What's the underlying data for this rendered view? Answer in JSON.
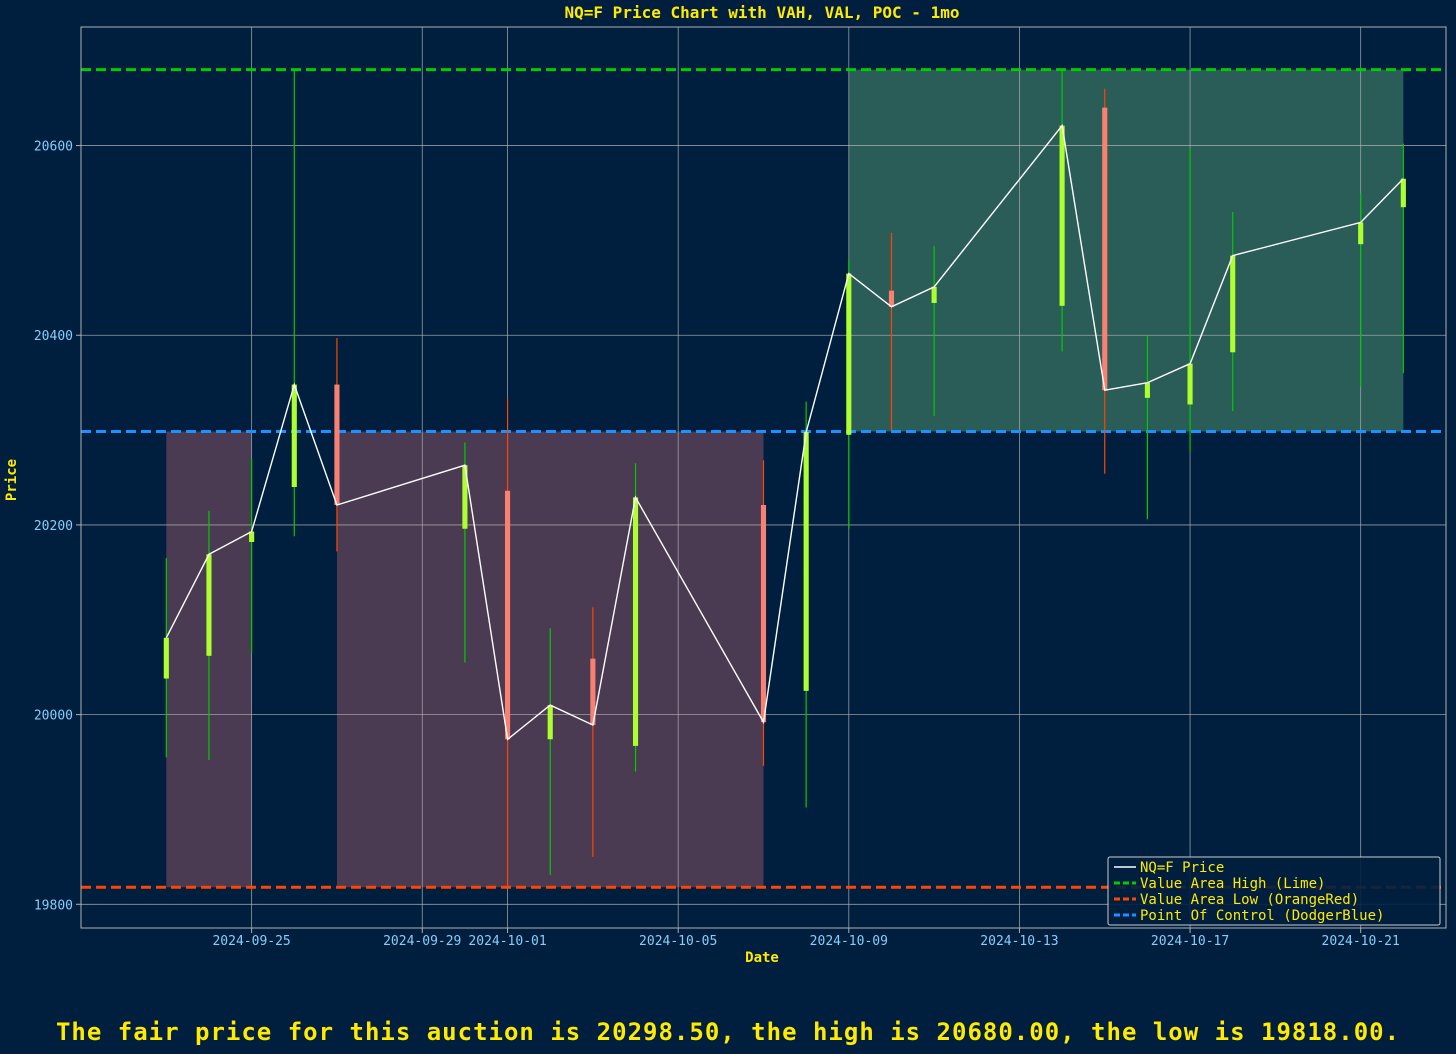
{
  "chart_data": {
    "type": "candlestick",
    "title": "NQ=F Price Chart with VAH, VAL, POC - 1mo",
    "xlabel": "Date",
    "ylabel": "Price",
    "ylim": [
      19775,
      20725
    ],
    "xlim": [
      "2024-09-21",
      "2024-10-23"
    ],
    "x_ticks": [
      "2024-09-25",
      "2024-09-29",
      "2024-10-01",
      "2024-10-05",
      "2024-10-09",
      "2024-10-13",
      "2024-10-17",
      "2024-10-21"
    ],
    "y_ticks": [
      19800,
      20000,
      20200,
      20400,
      20600
    ],
    "grid": true,
    "legend_position": "bottom-right",
    "legend": [
      {
        "label": "NQ=F Price",
        "color": "#ffffff",
        "style": "solid"
      },
      {
        "label": "Value Area High (Lime)",
        "color": "#00cc00",
        "style": "dashed"
      },
      {
        "label": "Value Area Low (OrangeRed)",
        "color": "#ff4500",
        "style": "dashed"
      },
      {
        "label": "Point Of Control (DodgerBlue)",
        "color": "#1e90ff",
        "style": "dashed"
      }
    ],
    "levels": {
      "vah": 20680.0,
      "val": 19818.0,
      "poc": 20298.5
    },
    "colors": {
      "background": "#001f3f",
      "up": "#adff2f",
      "down": "#fa8072",
      "up_wick": "#00cc00",
      "down_wick": "#ff4500",
      "title": "#ffea00",
      "tick": "#87cefa",
      "below_poc_region": "#4a3a52",
      "above_poc_region": "#2a5c58"
    },
    "candles": [
      {
        "date": "2024-09-23",
        "open": 20038,
        "high": 20165,
        "low": 19955,
        "close": 20081
      },
      {
        "date": "2024-09-24",
        "open": 20062,
        "high": 20215,
        "low": 19952,
        "close": 20169
      },
      {
        "date": "2024-09-25",
        "open": 20182,
        "high": 20270,
        "low": 20065,
        "close": 20193
      },
      {
        "date": "2024-09-26",
        "open": 20240,
        "high": 20680,
        "low": 20188,
        "close": 20348
      },
      {
        "date": "2024-09-27",
        "open": 20348,
        "high": 20397,
        "low": 20172,
        "close": 20221
      },
      {
        "date": "2024-09-30",
        "open": 20196,
        "high": 20287,
        "low": 20055,
        "close": 20263
      },
      {
        "date": "2024-10-01",
        "open": 20236,
        "high": 20333,
        "low": 19818,
        "close": 19974
      },
      {
        "date": "2024-10-02",
        "open": 19974,
        "high": 20091,
        "low": 19831,
        "close": 20010
      },
      {
        "date": "2024-10-03",
        "open": 20059,
        "high": 20113,
        "low": 19850,
        "close": 19989
      },
      {
        "date": "2024-10-04",
        "open": 19967,
        "high": 20265,
        "low": 19940,
        "close": 20229
      },
      {
        "date": "2024-10-07",
        "open": 20221,
        "high": 20268,
        "low": 19946,
        "close": 19992
      },
      {
        "date": "2024-10-08",
        "open": 20025,
        "high": 20330,
        "low": 19902,
        "close": 20298
      },
      {
        "date": "2024-10-09",
        "open": 20295,
        "high": 20480,
        "low": 20196,
        "close": 20465
      },
      {
        "date": "2024-10-10",
        "open": 20447,
        "high": 20508,
        "low": 20300,
        "close": 20430
      },
      {
        "date": "2024-10-11",
        "open": 20434,
        "high": 20494,
        "low": 20315,
        "close": 20451
      },
      {
        "date": "2024-10-14",
        "open": 20431,
        "high": 20680,
        "low": 20383,
        "close": 20621
      },
      {
        "date": "2024-10-15",
        "open": 20640,
        "high": 20660,
        "low": 20254,
        "close": 20342
      },
      {
        "date": "2024-10-16",
        "open": 20334,
        "high": 20400,
        "low": 20206,
        "close": 20350
      },
      {
        "date": "2024-10-17",
        "open": 20327,
        "high": 20598,
        "low": 20277,
        "close": 20370
      },
      {
        "date": "2024-10-18",
        "open": 20382,
        "high": 20530,
        "low": 20320,
        "close": 20484
      },
      {
        "date": "2024-10-21",
        "open": 20496,
        "high": 20550,
        "low": 20346,
        "close": 20519
      },
      {
        "date": "2024-10-22",
        "open": 20535,
        "high": 20602,
        "low": 20360,
        "close": 20565
      }
    ],
    "value_areas": [
      {
        "start": "2024-09-23",
        "end": "2024-09-25",
        "low": 19818,
        "high": 20298.5,
        "region": "below_poc"
      },
      {
        "start": "2024-09-27",
        "end": "2024-10-07",
        "low": 19818,
        "high": 20298.5,
        "region": "below_poc"
      },
      {
        "start": "2024-10-09",
        "end": "2024-10-22",
        "low": 20298.5,
        "high": 20680,
        "region": "above_poc"
      }
    ]
  },
  "footer_text": "The fair price for this auction is 20298.50, the high is 20680.00, the low is 19818.00."
}
